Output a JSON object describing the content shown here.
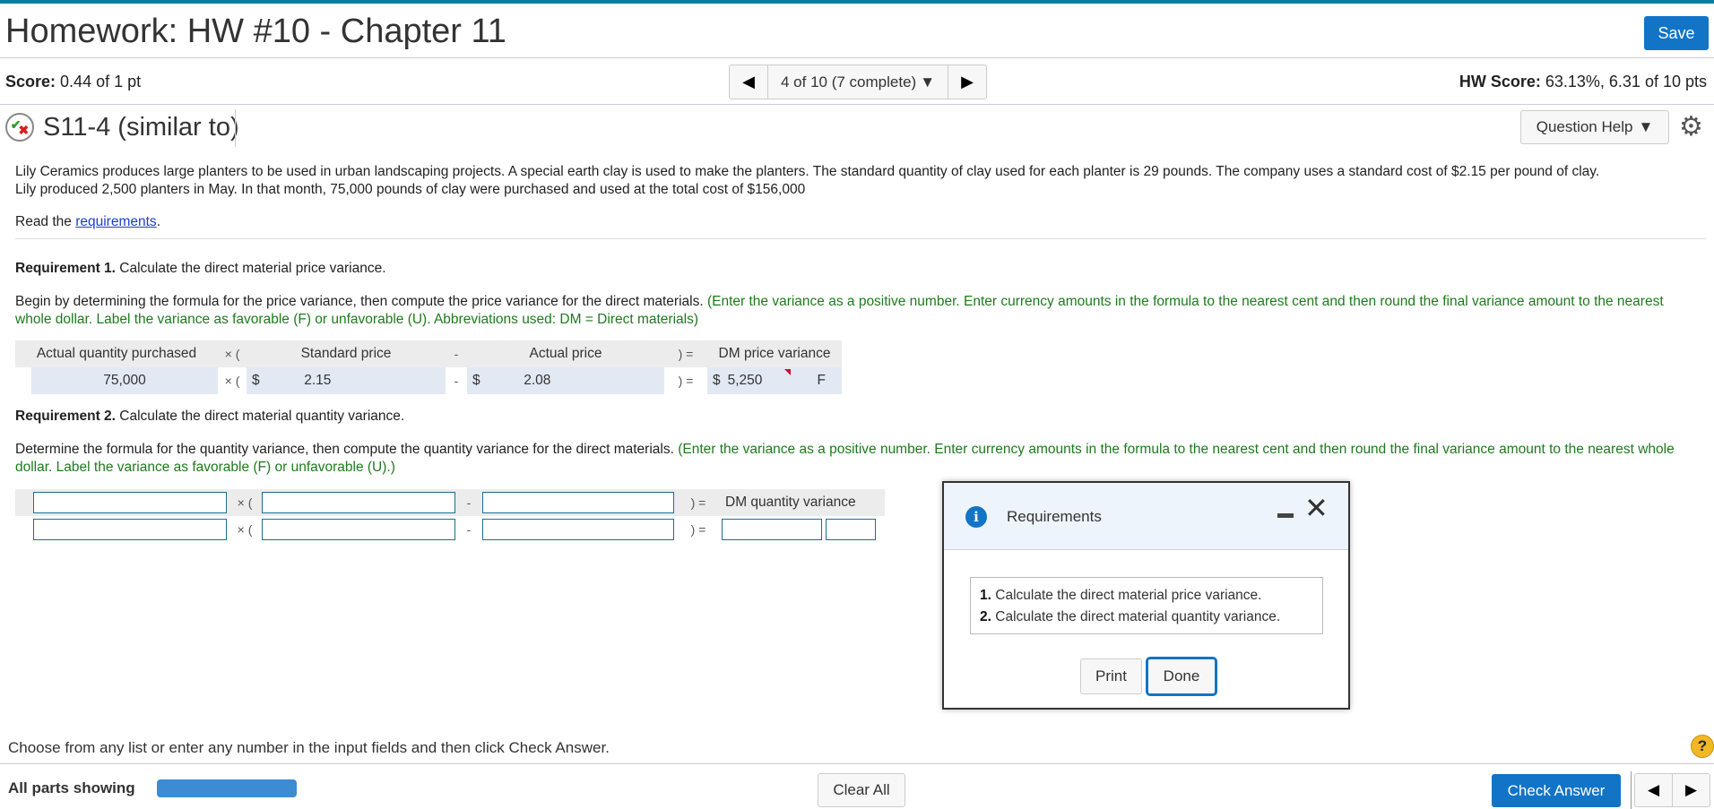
{
  "header": {
    "title": "Homework: HW #10 - Chapter 11",
    "save_label": "Save"
  },
  "score_bar": {
    "score_label": "Score:",
    "score_value": "0.44 of 1 pt",
    "nav_text": "4 of 10 (7 complete)",
    "hw_score_label": "HW Score:",
    "hw_score_value": "63.13%, 6.31 of 10 pts"
  },
  "question": {
    "title": "S11-4 (similar to)",
    "status_icon": "partial-credit-icon",
    "help_label": "Question Help"
  },
  "problem": {
    "text_line1": "Lily Ceramics produces large planters to be used in urban landscaping projects. A special earth clay is used to make the planters. The standard quantity of clay used for each planter is 29 pounds. The company uses a standard cost of $2.15 per pound of clay.",
    "text_line2": "Lily produced 2,500 planters in May. In that month, 75,000 pounds of clay were purchased and used at the total cost of $156,000",
    "read_prefix": "Read the ",
    "read_link": "requirements",
    "read_suffix": "."
  },
  "req1": {
    "label": "Requirement 1.",
    "text": " Calculate the direct material price variance.",
    "instr_black": "Begin by determining the formula for the price variance, then compute the price variance for the direct materials. ",
    "instr_green": "(Enter the variance as a positive number. Enter currency amounts in the formula to the nearest cent and then round the final variance amount to the nearest whole dollar. Label the variance as favorable (F) or unfavorable (U). Abbreviations used: DM = Direct materials)",
    "headers": [
      "Actual quantity purchased",
      "Standard price",
      "Actual price",
      "DM price variance"
    ],
    "values": {
      "actual_quantity": "75,000",
      "standard_price_currency": "$",
      "standard_price": "2.15",
      "actual_price_currency": "$",
      "actual_price": "2.08",
      "variance_currency": "$",
      "variance": "5,250",
      "variance_label": "F"
    },
    "ops": {
      "times_open": "× (",
      "minus": "-",
      "close_eq": ") ="
    }
  },
  "req2": {
    "label": "Requirement 2.",
    "text": " Calculate the direct material quantity variance.",
    "instr_black": "Determine the formula for the quantity variance, then compute the quantity variance for the direct materials. ",
    "instr_green": "(Enter the variance as a positive number. Enter currency amounts in the formula to the nearest cent and then round the final variance amount to the nearest whole dollar. Label the variance as favorable (F) or unfavorable (U).)",
    "result_header": "DM quantity variance",
    "ops": {
      "times_open": "× (",
      "minus": "-",
      "close_eq": ") ="
    }
  },
  "dialog": {
    "title": "Requirements",
    "items": [
      {
        "num": "1.",
        "text": "Calculate the direct material price variance."
      },
      {
        "num": "2.",
        "text": "Calculate the direct material quantity variance."
      }
    ],
    "print_label": "Print",
    "done_label": "Done"
  },
  "footer": {
    "instruction": "Choose from any list or enter any number in the input fields and then click Check Answer.",
    "all_parts": "All parts showing",
    "progress": 1.0,
    "clear_all": "Clear All",
    "check_answer": "Check Answer",
    "help_glyph": "?"
  },
  "colors": {
    "accent": "#1274c6",
    "topbar": "#007fa3",
    "instruction_green": "#1d7b1d",
    "link": "#1a3fcc"
  }
}
